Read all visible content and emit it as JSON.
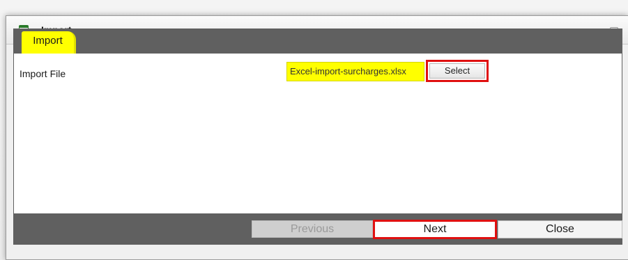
{
  "window": {
    "title": "Import",
    "maximize_icon": "maximize-icon",
    "close_icon": "close-icon",
    "close_glyph": "⊠"
  },
  "tabs": [
    {
      "label": "Import",
      "active": true,
      "color": "#ffff00"
    }
  ],
  "form": {
    "import_file_label": "Import File",
    "import_file_value": "Excel-import-surcharges.xlsx",
    "select_label": "Select"
  },
  "footer": {
    "previous_label": "Previous",
    "previous_enabled": false,
    "next_label": "Next",
    "close_label": "Close"
  },
  "colors": {
    "highlight": "#ffff00",
    "callout": "#e01010",
    "bar": "#606060"
  }
}
